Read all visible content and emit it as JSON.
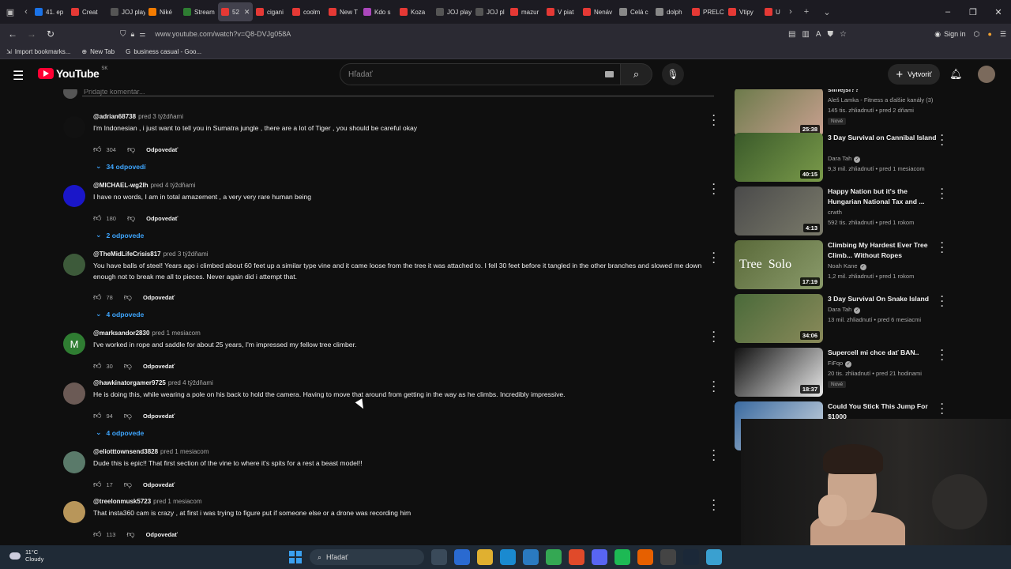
{
  "browser": {
    "tabs": [
      {
        "label": "41. ep",
        "color": "#1a73e8",
        "active": false
      },
      {
        "label": "Creat",
        "color": "#e53935",
        "active": false
      },
      {
        "label": "JOJ play",
        "color": "#555555",
        "active": false
      },
      {
        "label": "Niké",
        "color": "#f57c00",
        "active": false
      },
      {
        "label": "Stream",
        "color": "#2e7d32",
        "active": false
      },
      {
        "label": "52",
        "color": "#e53935",
        "active": true
      },
      {
        "label": "cigani",
        "color": "#e53935",
        "active": false
      },
      {
        "label": "coolm",
        "color": "#e53935",
        "active": false
      },
      {
        "label": "New T",
        "color": "#e53935",
        "active": false
      },
      {
        "label": "Kdo s",
        "color": "#ab47bc",
        "active": false
      },
      {
        "label": "Koza",
        "color": "#e53935",
        "active": false
      },
      {
        "label": "JOJ play",
        "color": "#555555",
        "active": false
      },
      {
        "label": "JOJ pl",
        "color": "#555555",
        "active": false
      },
      {
        "label": "mazur",
        "color": "#e53935",
        "active": false
      },
      {
        "label": "V piat",
        "color": "#e53935",
        "active": false
      },
      {
        "label": "Nenáv",
        "color": "#e53935",
        "active": false
      },
      {
        "label": "Celá c",
        "color": "#888888",
        "active": false
      },
      {
        "label": "dolph",
        "color": "#888888",
        "active": false
      },
      {
        "label": "PRELC",
        "color": "#e53935",
        "active": false
      },
      {
        "label": "Vtipy",
        "color": "#e53935",
        "active": false
      },
      {
        "label": "U",
        "color": "#e53935",
        "active": false
      }
    ],
    "url": "www.youtube.com/watch?v=Q8-DVJg058A",
    "sign_in": "Sign in",
    "bookmarks": [
      "Import bookmarks...",
      "New Tab",
      "business casual - Goo..."
    ]
  },
  "youtube": {
    "logo_text": "YouTube",
    "country": "SK",
    "search_placeholder": "Hľadať",
    "create_label": "Vytvoriť",
    "add_comment_placeholder": "Pridajte komentár...",
    "reply_label": "Odpovedať"
  },
  "comments": [
    {
      "author": "@adrian68738",
      "time": "pred 3 týždňami",
      "text": "I'm Indonesian , i just want to tell you in Sumatra jungle , there are a lot of Tiger  , you should be careful okay",
      "likes": "304",
      "replies": "34 odpovedí",
      "avatar_color": "#111111",
      "avatar_letter": "",
      "avatar_text_color": "#ffffff"
    },
    {
      "author": "@MICHAEL-wg2lh",
      "time": "pred 4 týždňami",
      "text": "I have no words, I am in total amazement , a very very rare human being",
      "likes": "180",
      "replies": "2 odpovede",
      "avatar_color": "#1a16c9",
      "avatar_letter": "",
      "avatar_text_color": "#ffffff"
    },
    {
      "author": "@TheMidLifeCrisis817",
      "time": "pred 3 týždňami",
      "text": "You have balls of steel! Years ago i climbed about 60 feet up a similar type vine and it came loose from the tree it was attached to. I fell 30 feet before it tangled in the other branches and slowed me down enough not to break me all to pieces. Never again did i attempt that.",
      "likes": "78",
      "replies": "4 odpovede",
      "avatar_color": "#3d5a3a",
      "avatar_letter": "",
      "avatar_text_color": "#ffffff"
    },
    {
      "author": "@marksandor2830",
      "time": "pred 1 mesiacom",
      "text": "I've worked in rope and saddle for about 25 years, I'm impressed my fellow tree climber.",
      "likes": "30",
      "replies": "",
      "avatar_color": "#2f7d32",
      "avatar_letter": "M",
      "avatar_text_color": "#ffffff"
    },
    {
      "author": "@hawkinatorgamer9725",
      "time": "pred 4 týždňami",
      "text": "He is doing this, while wearing a pole on his back to hold the camera. Having to move that around from getting in the way as he climbs. Incredibly impressive.",
      "likes": "94",
      "replies": "4 odpovede",
      "avatar_color": "#6b5a55",
      "avatar_letter": "",
      "avatar_text_color": "#ffffff"
    },
    {
      "author": "@eliotttownsend3828",
      "time": "pred 1 mesiacom",
      "text": "Dude this is epic!! That first section of the vine to where it's spits for a rest a beast model!!",
      "likes": "17",
      "replies": "",
      "avatar_color": "#5a7a6a",
      "avatar_letter": "",
      "avatar_text_color": "#ffffff"
    },
    {
      "author": "@treelonmusk5723",
      "time": "pred 1 mesiacom",
      "text": "That insta360 cam is crazy , at first i was trying to figure put if someone else or a drone was recording him",
      "likes": "113",
      "replies": "",
      "avatar_color": "#b8965a",
      "avatar_letter": "",
      "avatar_text_color": "#ffffff"
    }
  ],
  "recommendations": [
    {
      "title": "silnejší??",
      "channel": "Aleš Lamka - Fitness a ďalšie kanály (3)",
      "verified": false,
      "stats": "145 tis. zhliadnutí • pred 2 dňami",
      "duration": "25:38",
      "badge": "Nové",
      "thumb_colors": [
        "#6b7a4a",
        "#c9a090"
      ],
      "thumb_word": ""
    },
    {
      "title": "3 Day Survival on Cannibal Island",
      "channel": "Dara Tah",
      "verified": true,
      "stats": "9,3 mil. zhliadnutí • pred 1 mesiacom",
      "duration": "40:15",
      "badge": "",
      "thumb_colors": [
        "#3a5a2a",
        "#7a9a4a"
      ],
      "thumb_word": ""
    },
    {
      "title": "Happy Nation but it's the Hungarian National Tax and ...",
      "channel": "crwth",
      "verified": false,
      "stats": "592 tis. zhliadnutí • pred 1 rokom",
      "duration": "4:13",
      "badge": "",
      "thumb_colors": [
        "#4a4a4a",
        "#7a7a6a"
      ],
      "thumb_word": ""
    },
    {
      "title": "Climbing My Hardest Ever Tree Climb... Without Ropes",
      "channel": "Noah Kane",
      "verified": true,
      "stats": "1,2 mil. zhliadnutí • pred 1 rokom",
      "duration": "17:19",
      "badge": "",
      "thumb_colors": [
        "#5a6a3a",
        "#8a9a6a"
      ],
      "thumb_word": "Tree  Solo"
    },
    {
      "title": "3 Day Survival On Snake Island",
      "channel": "Dara Tah",
      "verified": true,
      "stats": "13 mil. zhliadnutí • pred 6 mesiacmi",
      "duration": "34:06",
      "badge": "",
      "thumb_colors": [
        "#4a6a3a",
        "#8a8a5a"
      ],
      "thumb_word": ""
    },
    {
      "title": "Supercell mi chce dať BAN..",
      "channel": "FiFqo",
      "verified": true,
      "stats": "20 tis. zhliadnutí • pred 21 hodinami",
      "duration": "18:37",
      "badge": "Nové",
      "thumb_colors": [
        "#111111",
        "#e8e8e8"
      ],
      "thumb_word": ""
    },
    {
      "title": "Could You Stick This Jump For $1000",
      "channel": "",
      "verified": false,
      "stats": "",
      "duration": "",
      "badge": "",
      "thumb_colors": [
        "#3a6aa0",
        "#d0d8e0"
      ],
      "thumb_word": ""
    }
  ],
  "taskbar": {
    "temperature": "11°C",
    "weather": "Cloudy",
    "search_label": "Hľadať",
    "apps": [
      {
        "name": "task-view",
        "color": "#3a4a5a"
      },
      {
        "name": "store",
        "color": "#2a6ad0"
      },
      {
        "name": "file-explorer",
        "color": "#e0b030"
      },
      {
        "name": "edge",
        "color": "#1a8ad0"
      },
      {
        "name": "app-blue",
        "color": "#2a7ac0"
      },
      {
        "name": "chrome",
        "color": "#34a853"
      },
      {
        "name": "brave",
        "color": "#e04a2a"
      },
      {
        "name": "discord",
        "color": "#5865f2"
      },
      {
        "name": "spotify",
        "color": "#1db954"
      },
      {
        "name": "firefox",
        "color": "#e66000"
      },
      {
        "name": "obs",
        "color": "#444444"
      },
      {
        "name": "steam",
        "color": "#1b2838"
      },
      {
        "name": "notepad",
        "color": "#3aa0d0"
      }
    ]
  }
}
